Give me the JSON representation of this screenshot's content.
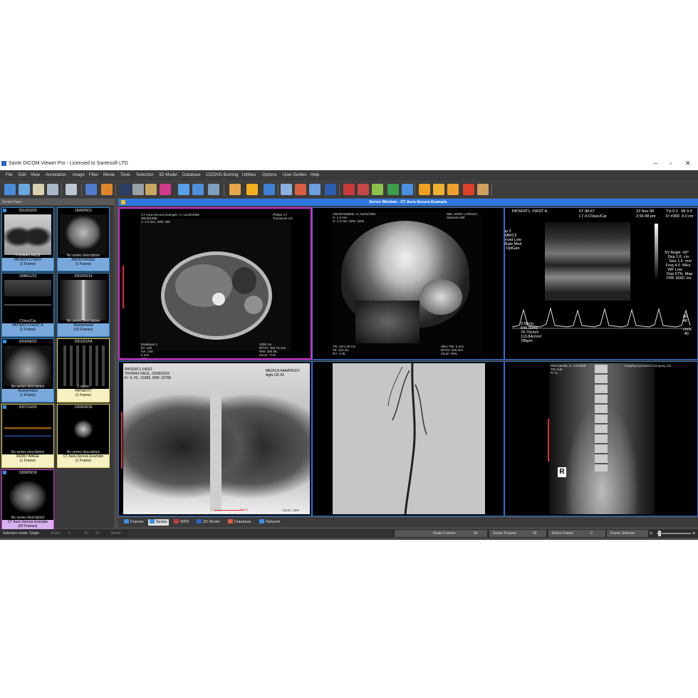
{
  "window": {
    "title": "Sante DICOM Viewer Pro - Licensed to Santesoft LTD",
    "controls": [
      "–",
      "▫",
      "✕"
    ]
  },
  "menu": [
    "File",
    "Edit",
    "View",
    "Annotation",
    "Image",
    "Filter",
    "Movie",
    "Tools",
    "Selection",
    "3D Model",
    "Database",
    "CD/DVD Burning",
    "Utilities",
    "Options",
    "User Guides",
    "Help"
  ],
  "series_pane": {
    "title": "Series Pane",
    "thumbs": [
      {
        "date": "2010/03/03",
        "desc": "THORAX FACE",
        "cap1": "PATIENT1 FIRST",
        "cap2": "(1 Frame)"
      },
      {
        "date": "1999/09/11",
        "desc": "No series description",
        "cap1": "ANONYMIZED",
        "cap2": "(1 Frame)"
      },
      {
        "date": "1998/11/23",
        "desc": "CVasc/Car",
        "cap1": "PATIENT1 FIRST A",
        "cap2": "(1 Frame)"
      },
      {
        "date": "2002/03/14",
        "desc": "No series description",
        "cap1": "Anonymized",
        "cap2": "(15 Frames)"
      },
      {
        "date": "2004/09/22",
        "desc": "No series description",
        "cap1": "Anonymized",
        "cap2": "(1 Frame)"
      },
      {
        "date": "2001/01/04",
        "desc": "L-spine",
        "cap1": "PATIENT7",
        "cap2": "(1 Frame)"
      },
      {
        "date": "2007/10/03",
        "desc": "No series description",
        "cap1": "DEMO IMAGE",
        "cap2": "(1 Frame)"
      },
      {
        "date": "1999/09/18",
        "desc": "No series description",
        "cap1": "CT Aura-Secura Example",
        "cap2": "(1 Frame)"
      },
      {
        "date": "1999/09/18",
        "desc": "No series description",
        "cap1": "CT Aura-Secura Example",
        "cap2": "(92 Frames)"
      }
    ]
  },
  "series_window": {
    "title": "Series Window - CT Aura-Secura Example"
  },
  "overlays": {
    "ct_top": "CT Aura-Secura Example, H, 12/18/1999\n08/18/1999\n1: 1.0 mm, WW: 400",
    "ct_tr": "Philips CT\nTomoscan CS",
    "ct_bl": "Database 1\nkV: 120\nmA: 240\n5 mm\nH:C",
    "ct_br": "1000 ms\nDFOV: 363.75 mm\nWW: 356 ML\nZoom: 71%",
    "mr_top": "ANONYMIZED, H, 01/01/1991\nH: 1.0 mm\nH: 1.0 mm, WW: 1000",
    "mr_tr": "SBL HOSP. LARISSA\nSiemens MR",
    "mr_bl": "TR: 4471.40 ms\nTE: 113 ms\nRA: 4:45",
    "mr_br": "Slice Thk: 6 mm\nDFOV: 220 mm\nZoom: 69%",
    "us_patient": "PATIENT1, FIRST A.",
    "us_date": "67-98-67",
    "us_probe": "L7-4 CVasc/Car",
    "us_date2": "23 Nov 98",
    "us_time": "2:55:48 pm",
    "us_tis": "TIs 0.2   MI 0.4",
    "us_fr": "Fr #369  4.0 cm",
    "us_left": "ap 2\n0dB/C3\nersist Low\n Rate Med\n) OptGen",
    "us_right": "SV Angle -60°\n   Dep 1.6  cm\n    Size 1.5  mm\n Freq 4.0  MHz\n   WF Low\n  Dop 57%  Map\n  PRF 5000  Hz",
    "us_meas": "0.60cm\n640.00ms\n76.70cm/s\n119.84cm/s²\n78bpm",
    "us_scale": "80\n40\n\ncm/s\n-40",
    "xr_top": "PATIENT1 FIRST\nTHORAX FACE, 03/09/2016\nFr: 0, HL: 16383, WW: 32768",
    "xr_tr": "MEDICA FAAATEIOY\nAgfa CR 35",
    "xr_zoom": "Zoom: 18%",
    "xr_scale": "10cm",
    "sp_top": "Pitch,Media, H, 1/1/2000\nThe sub...\nFr: 0, ...",
    "sp_tr": "Imaging Dynamics Company Ltd.",
    "sp_r": "R"
  },
  "tabs": [
    "Frames",
    "Series",
    "MPR",
    "3D Model",
    "Database",
    "Network"
  ],
  "status": {
    "mode": "Selection mode: Single",
    "from": "From:",
    "from_v": "0",
    "to": "To:",
    "to_v": "91",
    "reset": "Reset",
    "study_frames_label": "Study Frames:",
    "study_frames": "93",
    "series_frames_label": "Series Frames:",
    "series_frames": "92",
    "active_frame_label": "Active Frame:",
    "active_frame": "0",
    "frame_selector": "Frame Selector"
  },
  "colors": {
    "accent": "#2f78e0",
    "active": "#d030d0",
    "thumb_blue": "#79a8dc"
  }
}
